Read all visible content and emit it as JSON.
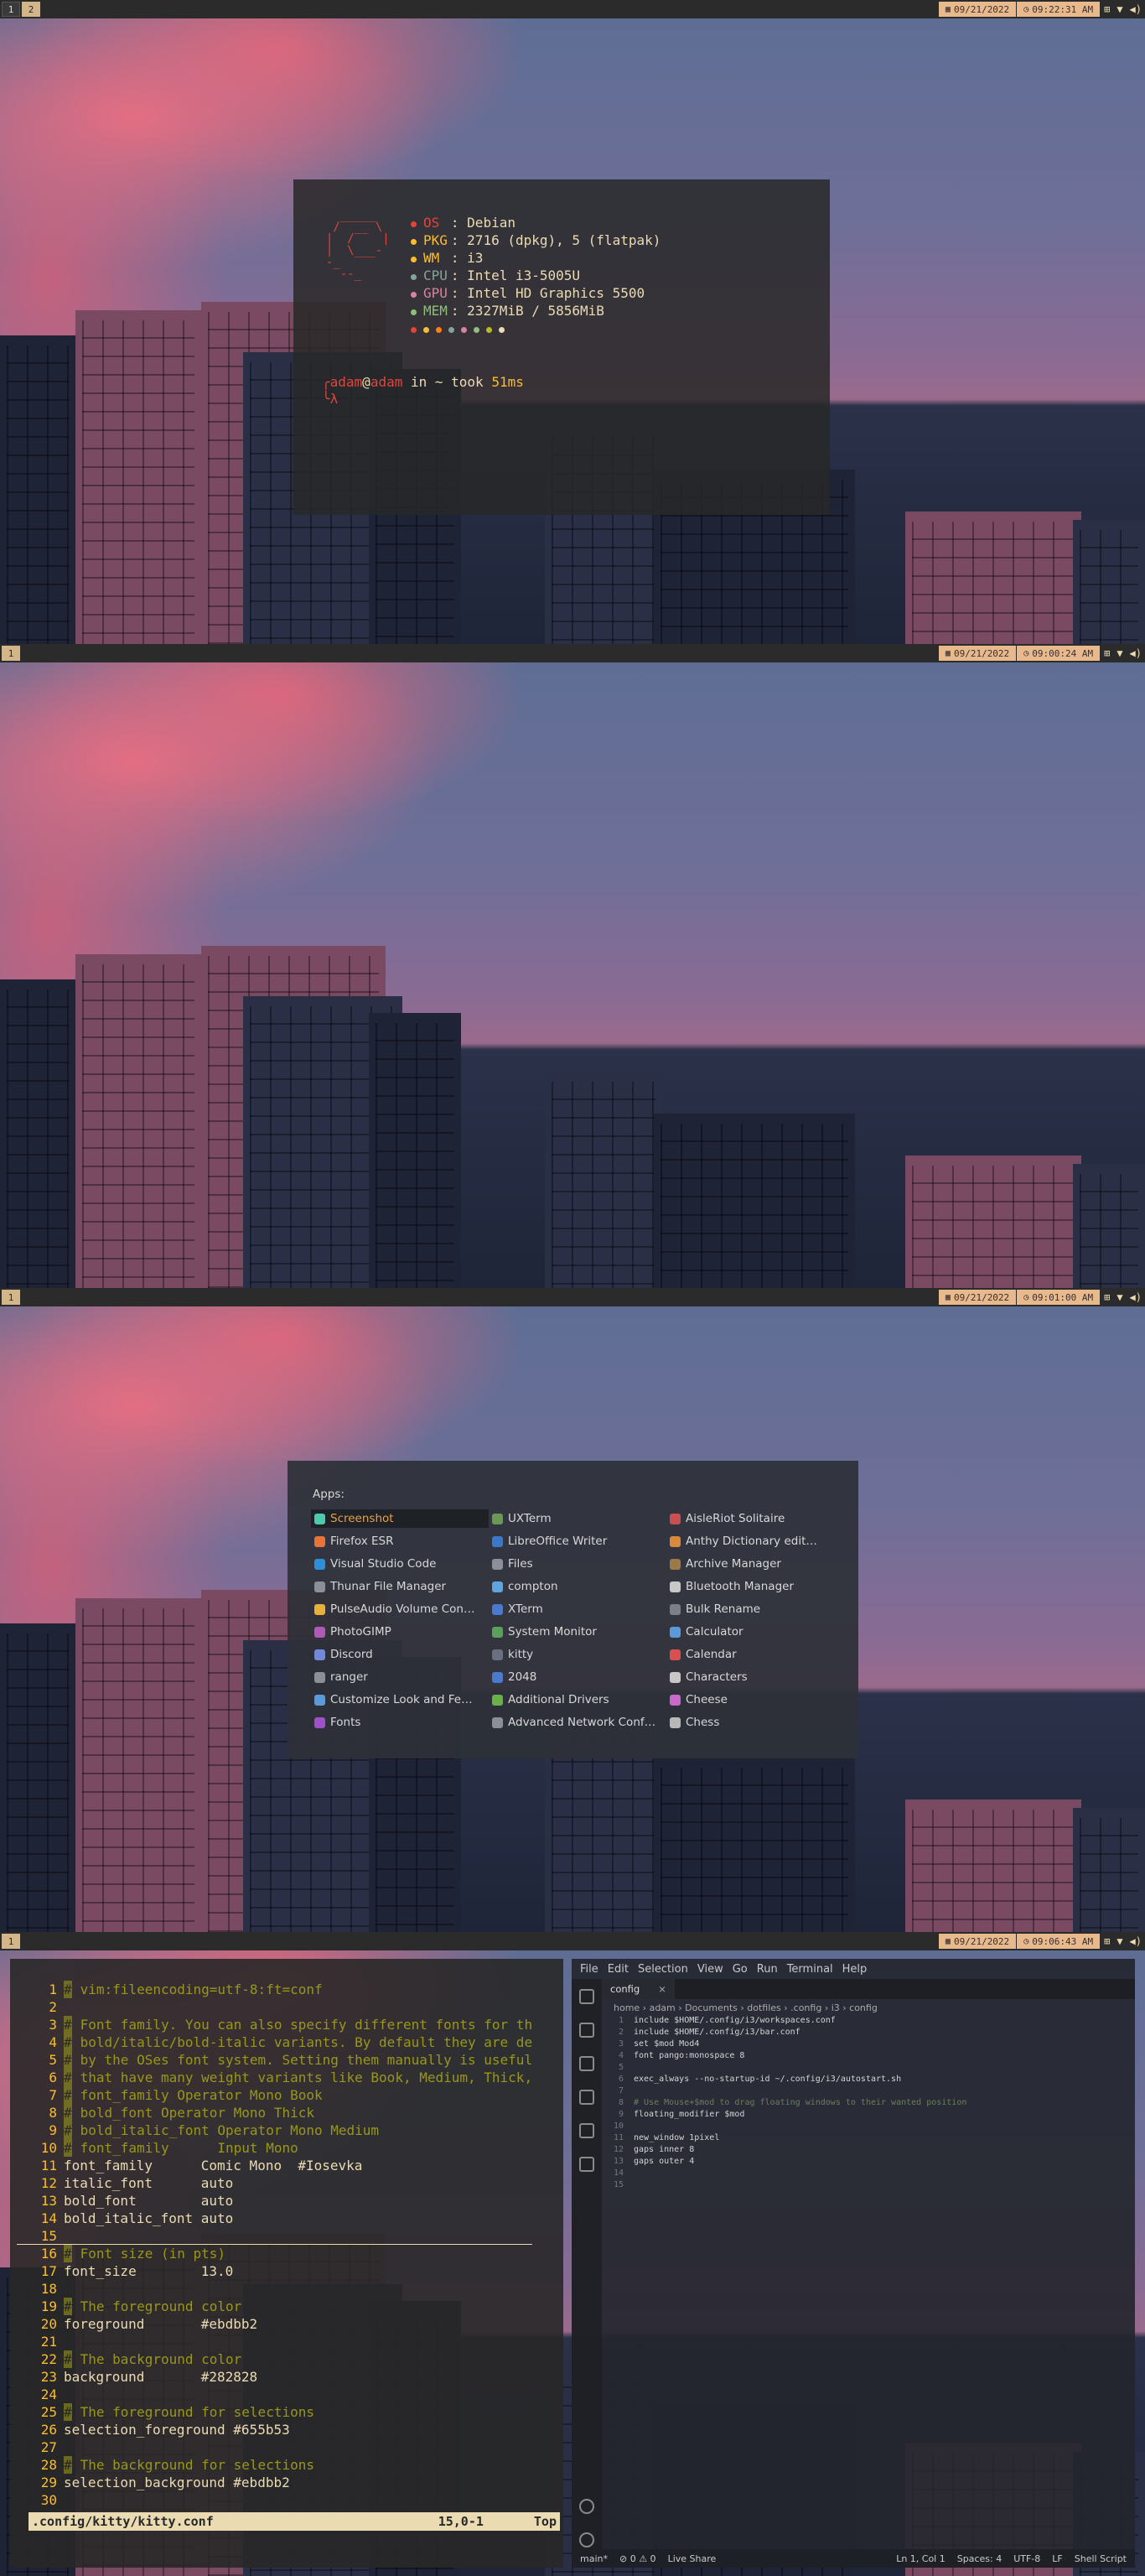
{
  "screens": [
    {
      "bar": {
        "workspaces": [
          "1",
          "2"
        ],
        "active": 1,
        "date": "09/21/2022",
        "time": "09:22:31 AM"
      },
      "terminal": {
        "info": [
          {
            "dot": "#e0453a",
            "key": "OS",
            "sep": " : ",
            "value": "Debian",
            "color": "#e0453a"
          },
          {
            "dot": "#fabd2f",
            "key": "PKG",
            "sep": ": ",
            "value": "2716 (dpkg), 5 (flatpak)",
            "color": "#fabd2f"
          },
          {
            "dot": "#fabd2f",
            "key": "WM",
            "sep": " : ",
            "value": "i3",
            "color": "#fabd2f"
          },
          {
            "dot": "#83a598",
            "key": "CPU",
            "sep": ": ",
            "value": "Intel i3-5005U",
            "color": "#83a598"
          },
          {
            "dot": "#d3869b",
            "key": "GPU",
            "sep": ": ",
            "value": "Intel HD Graphics 5500",
            "color": "#d3869b"
          },
          {
            "dot": "#8ec07c",
            "key": "MEM",
            "sep": ": ",
            "value": "2327MiB / 5856MiB",
            "color": "#8ec07c"
          }
        ],
        "palette": [
          "#e0453a",
          "#fabd2f",
          "#fe8019",
          "#83a598",
          "#d3869b",
          "#8ec07c",
          "#b8bb26",
          "#ebdbb2"
        ],
        "prompt": {
          "user": "adam",
          "at": "@",
          "host": "adam",
          "rest": " in ~ took ",
          "took": "51ms",
          "lambda": "λ"
        }
      }
    },
    {
      "bar": {
        "workspaces": [
          "1"
        ],
        "active": 0,
        "date": "09/21/2022",
        "time": "09:00:24 AM"
      }
    },
    {
      "bar": {
        "workspaces": [
          "1"
        ],
        "active": 0,
        "date": "09/21/2022",
        "time": "09:01:00 AM"
      },
      "launcher": {
        "heading": "Apps:",
        "apps": [
          {
            "label": "Screenshot",
            "color": "#4ec9b0"
          },
          {
            "label": "UXTerm",
            "color": "#6a9955"
          },
          {
            "label": "AisleRiot Solitaire",
            "color": "#c85050"
          },
          {
            "label": "Firefox ESR",
            "color": "#e8733a"
          },
          {
            "label": "LibreOffice Writer",
            "color": "#3b78c8"
          },
          {
            "label": "Anthy Dictionary edit…",
            "color": "#d88a3a"
          },
          {
            "label": "Visual Studio Code",
            "color": "#2d8fd8"
          },
          {
            "label": "Files",
            "color": "#8a8f9a"
          },
          {
            "label": "Archive Manager",
            "color": "#9c7a48"
          },
          {
            "label": "Thunar File Manager",
            "color": "#8a8f9a"
          },
          {
            "label": "compton",
            "color": "#5da6e0"
          },
          {
            "label": "Bluetooth Manager",
            "color": "#c8c8c8"
          },
          {
            "label": "PulseAudio Volume Con…",
            "color": "#e8b03a"
          },
          {
            "label": "XTerm",
            "color": "#4a7acf"
          },
          {
            "label": "Bulk Rename",
            "color": "#7a7f8a"
          },
          {
            "label": "PhotoGIMP",
            "color": "#b05ab8"
          },
          {
            "label": "System Monitor",
            "color": "#5aa05a"
          },
          {
            "label": "Calculator",
            "color": "#5a9ad8"
          },
          {
            "label": "Discord",
            "color": "#7289da"
          },
          {
            "label": "kitty",
            "color": "#6a7080"
          },
          {
            "label": "Calendar",
            "color": "#d85050"
          },
          {
            "label": "ranger",
            "color": "#8a8f9a"
          },
          {
            "label": "2048",
            "color": "#4a7acf"
          },
          {
            "label": "Characters",
            "color": "#c8c8c8"
          },
          {
            "label": "Customize Look and Fe…",
            "color": "#5a9ad8"
          },
          {
            "label": "Additional Drivers",
            "color": "#6ab04a"
          },
          {
            "label": "Cheese",
            "color": "#c86ac8"
          },
          {
            "label": "Fonts",
            "color": "#a050c8"
          },
          {
            "label": "Advanced Network Conf…",
            "color": "#8a8f9a"
          },
          {
            "label": "Chess",
            "color": "#b8b8b8"
          }
        ]
      }
    },
    {
      "bar": {
        "workspaces": [
          "1"
        ],
        "active": 0,
        "date": "09/21/2022",
        "time": "09:06:43 AM"
      },
      "vim": {
        "lines": [
          {
            "n": "1",
            "text": " vim:fileencoding=utf-8:ft=conf",
            "comment": true
          },
          {
            "n": "2",
            "text": "",
            "comment": false
          },
          {
            "n": "3",
            "text": " Font family. You can also specify different fonts for th",
            "comment": true
          },
          {
            "n": "4",
            "text": " bold/italic/bold-italic variants. By default they are de",
            "comment": true
          },
          {
            "n": "5",
            "text": " by the OSes font system. Setting them manually is useful",
            "comment": true
          },
          {
            "n": "6",
            "text": " that have many weight variants like Book, Medium, Thick,",
            "comment": true
          },
          {
            "n": "7",
            "text": " font_family Operator Mono Book",
            "comment": true
          },
          {
            "n": "8",
            "text": " bold_font Operator Mono Thick",
            "comment": true
          },
          {
            "n": "9",
            "text": " bold_italic_font Operator Mono Medium",
            "comment": true
          },
          {
            "n": "10",
            "text": " font_family      Input Mono",
            "comment": true
          },
          {
            "n": "11",
            "text": "font_family      Comic Mono  #Iosevka",
            "comment": false
          },
          {
            "n": "12",
            "text": "italic_font      auto",
            "comment": false
          },
          {
            "n": "13",
            "text": "bold_font        auto",
            "comment": false
          },
          {
            "n": "14",
            "text": "bold_italic_font auto",
            "comment": false
          },
          {
            "n": "15",
            "text": "",
            "comment": false
          },
          {
            "n": "16",
            "text": " Font size (in pts)",
            "comment": true
          },
          {
            "n": "17",
            "text": "font_size        13.0",
            "comment": false
          },
          {
            "n": "18",
            "text": "",
            "comment": false
          },
          {
            "n": "19",
            "text": " The foreground color",
            "comment": true
          },
          {
            "n": "20",
            "text": "foreground       #ebdbb2",
            "comment": false
          },
          {
            "n": "21",
            "text": "",
            "comment": false
          },
          {
            "n": "22",
            "text": " The background color",
            "comment": true
          },
          {
            "n": "23",
            "text": "background       #282828",
            "comment": false
          },
          {
            "n": "24",
            "text": "",
            "comment": false
          },
          {
            "n": "25",
            "text": " The foreground for selections",
            "comment": true
          },
          {
            "n": "26",
            "text": "selection_foreground #655b53",
            "comment": false
          },
          {
            "n": "27",
            "text": "",
            "comment": false
          },
          {
            "n": "28",
            "text": " The background for selections",
            "comment": true
          },
          {
            "n": "29",
            "text": "selection_background #ebdbb2",
            "comment": false
          },
          {
            "n": "30",
            "text": "",
            "comment": false
          }
        ],
        "status_file": ".config/kitty/kitty.conf",
        "status_pos": "15,0-1",
        "status_scroll": "Top"
      },
      "code": {
        "menu": [
          "File",
          "Edit",
          "Selection",
          "View",
          "Go",
          "Run",
          "Terminal",
          "Help"
        ],
        "tab": "config",
        "crumbs": "home › adam › Documents › dotfiles › .config › i3 › config",
        "lines": [
          {
            "n": "1",
            "text": "include $HOME/.config/i3/workspaces.conf"
          },
          {
            "n": "2",
            "text": "include $HOME/.config/i3/bar.conf"
          },
          {
            "n": "3",
            "text": "set $mod Mod4"
          },
          {
            "n": "4",
            "text": "font pango:monospace 8"
          },
          {
            "n": "5",
            "text": ""
          },
          {
            "n": "6",
            "text": "exec_always --no-startup-id ~/.config/i3/autostart.sh"
          },
          {
            "n": "7",
            "text": ""
          },
          {
            "n": "8",
            "text": "# Use Mouse+$mod to drag floating windows to their wanted position"
          },
          {
            "n": "9",
            "text": "floating_modifier $mod"
          },
          {
            "n": "10",
            "text": ""
          },
          {
            "n": "11",
            "text": "new_window 1pixel"
          },
          {
            "n": "12",
            "text": "gaps inner 8"
          },
          {
            "n": "13",
            "text": "gaps outer 4"
          },
          {
            "n": "14",
            "text": ""
          },
          {
            "n": "15",
            "text": ""
          }
        ],
        "status_left": [
          "main*",
          "⊘ 0 ⚠ 0",
          "Live Share"
        ],
        "status_right": [
          "Ln 1, Col 1",
          "Spaces: 4",
          "UTF-8",
          "LF",
          "Shell Script"
        ]
      }
    }
  ]
}
